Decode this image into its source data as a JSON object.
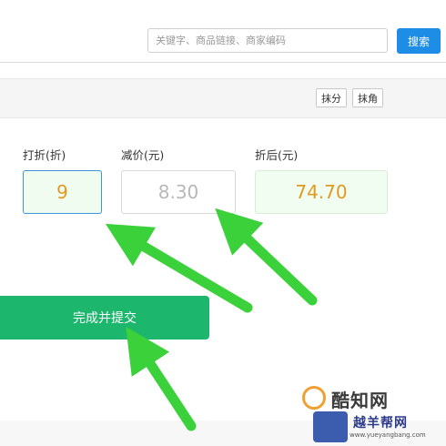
{
  "search": {
    "placeholder": "关键字、商品链接、商家编码",
    "button_label": "搜索"
  },
  "toolbar": {
    "round_fen_label": "抹分",
    "round_jiao_label": "抹角"
  },
  "discount": {
    "label": "打折(折)",
    "value": "9"
  },
  "reduction": {
    "label": "减价(元)",
    "value": "8.30"
  },
  "after": {
    "label": "折后(元)",
    "value": "74.70"
  },
  "submit": {
    "label": "完成并提交"
  },
  "watermark": {
    "line1": "酷知网",
    "line2": "越羊帮网",
    "url": "www.yueyangbang.com"
  },
  "colors": {
    "accent_blue": "#1e8de6",
    "submit_green": "#1db66d",
    "value_orange": "#e09a20",
    "arrow_green": "#3ad13a"
  }
}
